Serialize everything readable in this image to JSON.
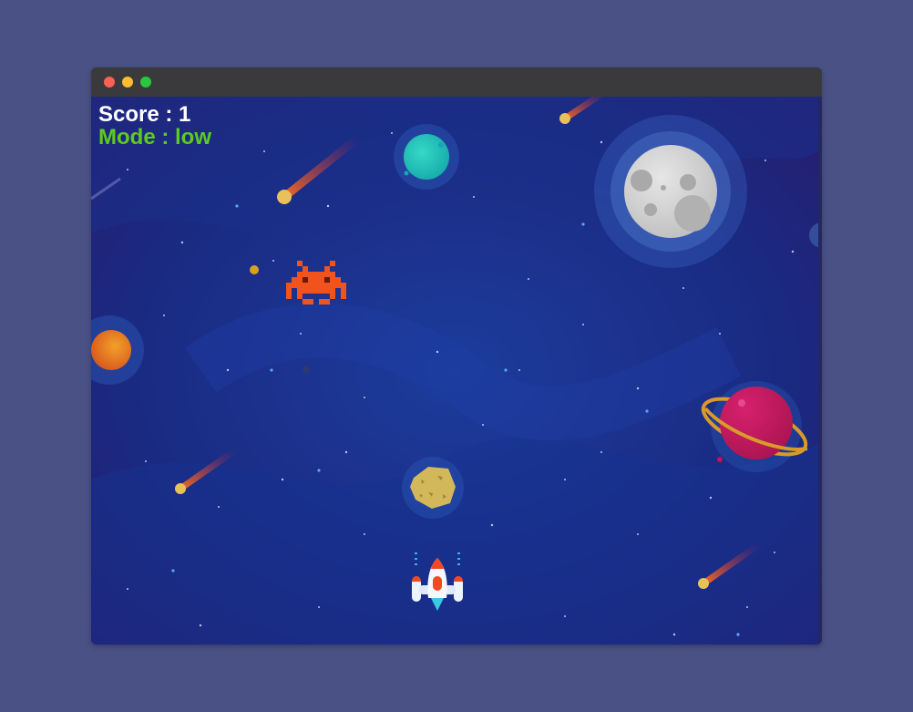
{
  "window": {
    "controls": [
      "close",
      "minimize",
      "zoom"
    ]
  },
  "hud": {
    "score_text": "Score : 1",
    "mode_text": "Mode : low"
  },
  "colors": {
    "page_background": "#4a5185",
    "space_background": "#1a1f5c",
    "score_color": "#ffffff",
    "mode_color": "#5ecb1f",
    "enemy_color": "#f2521c"
  },
  "sprites": {
    "player": "white-rocket-ship",
    "enemy": "orange-space-invader",
    "planets": [
      "teal-planet",
      "grey-moon",
      "orange-planet",
      "magenta-ringed-planet"
    ],
    "asteroid": "yellow-asteroid",
    "meteors": 6
  }
}
